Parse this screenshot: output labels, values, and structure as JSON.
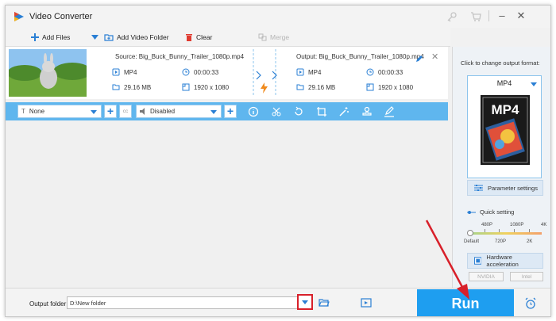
{
  "window": {
    "title": "Video Converter"
  },
  "toolbar": {
    "add_files": "Add Files",
    "add_video_folder": "Add Video Folder",
    "clear": "Clear",
    "merge": "Merge"
  },
  "file": {
    "source": "Source: Big_Buck_Bunny_Trailer_1080p.mp4",
    "output": "Output: Big_Buck_Bunny_Trailer_1080p.mp4",
    "src_format": "MP4",
    "src_duration": "00:00:33",
    "src_size": "29.16 MB",
    "src_resolution": "1920 x 1080",
    "out_format": "MP4",
    "out_duration": "00:00:33",
    "out_size": "29.16 MB",
    "out_resolution": "1920 x 1080"
  },
  "editbar": {
    "subtitle_select": "None",
    "audio_select": "Disabled",
    "cc_label": "cc"
  },
  "right_panel": {
    "change_format_label": "Click to change output format:",
    "format_name": "MP4",
    "format_art_text": "MP4",
    "parameter_settings": "Parameter settings",
    "quick_setting": "Quick setting",
    "quality_top": [
      "480P",
      "1080P",
      "4K"
    ],
    "quality_bottom": [
      "Default",
      "720P",
      "2K"
    ],
    "hardware_acceleration": "Hardware acceleration",
    "chips": [
      "NVIDIA",
      "Intel"
    ]
  },
  "bottom": {
    "output_folder_label": "Output folder:",
    "output_folder_value": "D:\\New folder",
    "run": "Run"
  },
  "colors": {
    "accent": "#1e9ef0",
    "editbar": "#5fb6ee",
    "highlight_red": "#d8202a",
    "lightning": "#f08a1c"
  }
}
